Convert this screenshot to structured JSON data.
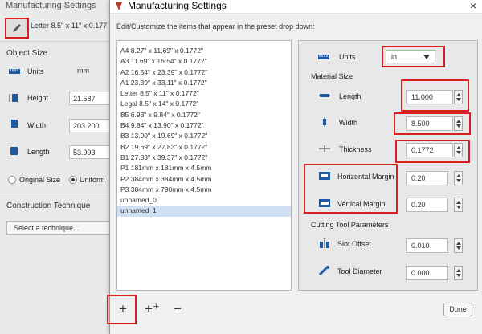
{
  "background_panel": {
    "title": "Manufacturing Settings",
    "preset_value": "Letter 8.5\" x 11\" x 0.177",
    "object_size_heading": "Object Size",
    "units_label": "Units",
    "units_value": "mm",
    "height_label": "Height",
    "height_value": "21.587",
    "width_label": "Width",
    "width_value": "203.200",
    "length_label": "Length",
    "length_value": "53.993",
    "original_size_label": "Original Size",
    "uniform_label": "Uniform",
    "construction_heading": "Construction Technique",
    "technique_button": "Select a technique..."
  },
  "dialog": {
    "title": "Manufacturing Settings",
    "close_glyph": "×",
    "instruction": "Edit/Customize the items that appear in the preset drop down:",
    "presets": [
      "A4 8.27\" x 11.69\" x 0.1772\"",
      "A3 11.69\" x 16.54\" x 0.1772\"",
      "A2 16.54\" x 23.39\" x 0.1772\"",
      "A1 23.39\" x 33.11\" x 0.1772\"",
      "Letter 8.5\" x 11\" x 0.1772\"",
      "Legal 8.5\" x 14\" x 0.1772\"",
      "B5 6.93\" x 9.84\" x 0.1772\"",
      "B4 9.84\" x 13.90\" x 0.1772\"",
      "B3 13.90\" x 19.69\" x 0.1772\"",
      "B2 19.69\" x 27.83\" x 0.1772\"",
      "B1 27.83\" x 39.37\" x 0.1772\"",
      "P1 181mm x 181mm x 4.5mm",
      "P2 384mm x 384mm x 4.5mm",
      "P3 384mm x 790mm x 4.5mm",
      "unnamed_0",
      "unnamed_1"
    ],
    "selected_preset_index": 15,
    "units_label": "Units",
    "units_value": "in",
    "material_size_heading": "Material Size",
    "length_label": "Length",
    "length_value": "11.000",
    "width_label": "Width",
    "width_value": "8.500",
    "thickness_label": "Thickness",
    "thickness_value": "0.1772",
    "h_margin_label": "Horizontal Margin",
    "h_margin_value": "0.20",
    "v_margin_label": "Vertical Margin",
    "v_margin_value": "0.20",
    "cutting_heading": "Cutting Tool Parameters",
    "slot_offset_label": "Slot Offset",
    "slot_offset_value": "0.010",
    "tool_diameter_label": "Tool Diameter",
    "tool_diameter_value": "0.000",
    "add_glyph": "+",
    "duplicate_glyph": "+⁺",
    "remove_glyph": "−",
    "done_label": "Done"
  },
  "colors": {
    "highlight_red": "#d82020",
    "icon_blue": "#1e5aa8",
    "selection_blue": "#cfe0f5"
  }
}
